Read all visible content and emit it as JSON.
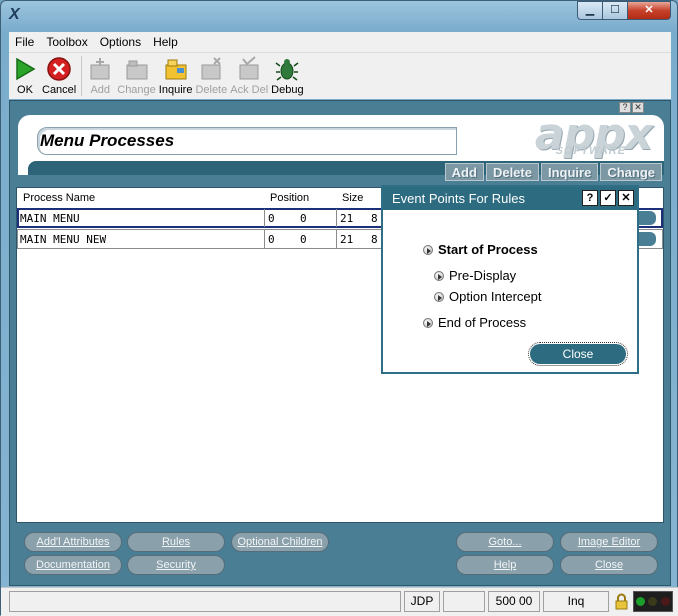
{
  "window": {
    "app_icon": "X",
    "controls": {
      "minimize": "▁",
      "maximize": "☐",
      "close": "✕"
    }
  },
  "menu": [
    "File",
    "Toolbox",
    "Options",
    "Help"
  ],
  "toolbar": [
    {
      "label": "OK",
      "icon": "play-icon",
      "enabled": true
    },
    {
      "label": "Cancel",
      "icon": "cancel-icon",
      "enabled": true
    },
    {
      "label": "Add",
      "icon": "add-icon",
      "enabled": false
    },
    {
      "label": "Change",
      "icon": "change-icon",
      "enabled": false
    },
    {
      "label": "Inquire",
      "icon": "inquire-icon",
      "enabled": true
    },
    {
      "label": "Delete",
      "icon": "delete-icon",
      "enabled": false
    },
    {
      "label": "Ack Del",
      "icon": "ack-delete-icon",
      "enabled": false
    },
    {
      "label": "Debug",
      "icon": "debug-icon",
      "enabled": true
    }
  ],
  "pane": {
    "title": "Menu Processes",
    "logo_main": "appx",
    "logo_sub": "SOFTWARE",
    "controls": [
      "?",
      "✕"
    ],
    "action_tabs": [
      "Add",
      "Delete",
      "Inquire",
      "Change"
    ]
  },
  "table": {
    "columns": [
      "Process Name",
      "Position",
      "Size"
    ],
    "rows": [
      {
        "name": "MAIN MENU",
        "pos1": "0",
        "pos2": "0",
        "size1": "21",
        "size2": "8"
      },
      {
        "name": "MAIN MENU NEW",
        "pos1": "0",
        "pos2": "0",
        "size1": "21",
        "size2": "8"
      }
    ]
  },
  "bottom_buttons": {
    "addl_attributes": "Add'l Attributes",
    "rules": "Rules",
    "optional_children": "Optional Children",
    "documentation": "Documentation",
    "security": "Security",
    "goto": "Goto...",
    "image_editor": "Image Editor",
    "help": "Help",
    "close": "Close"
  },
  "status": {
    "user": "JDP",
    "value": "500 00",
    "mode": "Inq"
  },
  "dialog": {
    "title": "Event Points For Rules",
    "controls": [
      "?",
      "✓",
      "✕"
    ],
    "options": {
      "start": "Start of Process",
      "pre_display": "Pre-Display",
      "option_intercept": "Option Intercept",
      "end": "End of Process"
    },
    "close_label": "Close"
  },
  "colors": {
    "accent": "#2d6b80",
    "pane_bg": "#4a7e94",
    "button_bg": "#8aa0ab"
  }
}
